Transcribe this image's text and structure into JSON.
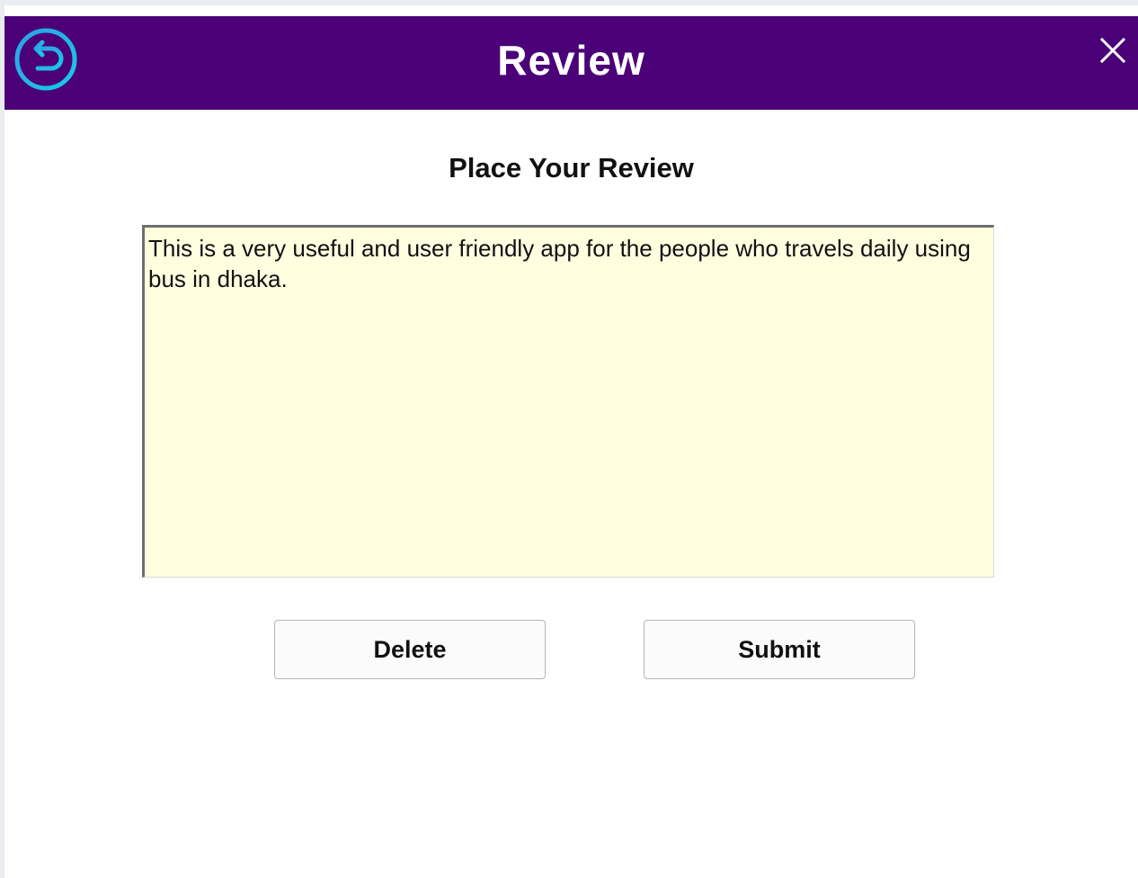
{
  "header": {
    "title": "Review",
    "background_color": "#4b0078",
    "back_icon": "back-arrow-icon",
    "close_label": "X"
  },
  "main": {
    "heading": "Place Your Review",
    "review_text": "This is a very useful and user friendly app for the people who travels daily using bus in dhaka.",
    "review_box_color": "#ffffe0"
  },
  "actions": {
    "delete_label": "Delete",
    "submit_label": "Submit"
  }
}
